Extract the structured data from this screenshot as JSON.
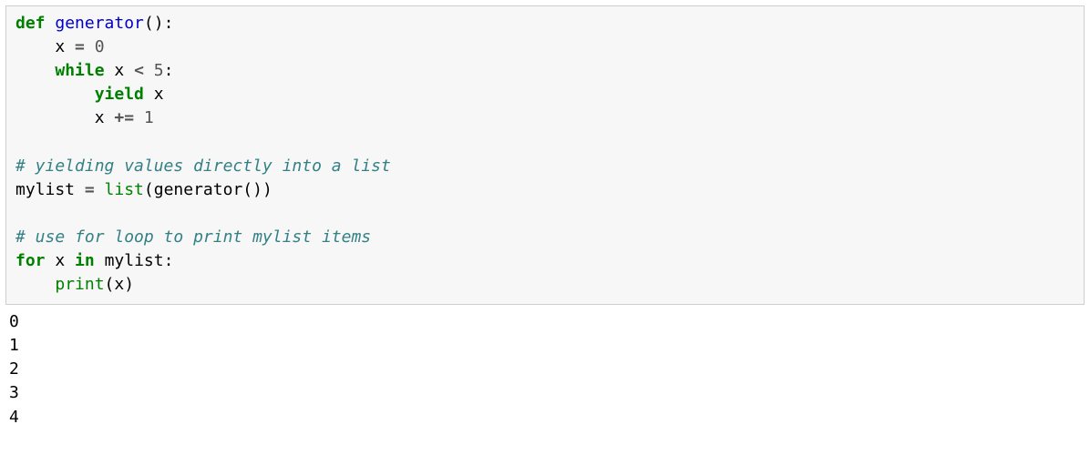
{
  "code": {
    "line1": {
      "def": "def",
      "sp1": " ",
      "fn": "generator",
      "paren": "():"
    },
    "line2": {
      "indent": "    ",
      "var": "x ",
      "op": "=",
      "sp": " ",
      "num": "0"
    },
    "line3": {
      "indent": "    ",
      "kw": "while",
      "sp1": " ",
      "var": "x ",
      "op": "<",
      "sp2": " ",
      "num": "5",
      "colon": ":"
    },
    "line4": {
      "indent": "        ",
      "kw": "yield",
      "sp": " ",
      "var": "x"
    },
    "line5": {
      "indent": "        ",
      "var": "x ",
      "op": "+=",
      "sp": " ",
      "num": "1"
    },
    "line6": "",
    "line7": {
      "comment": "# yielding values directly into a list"
    },
    "line8": {
      "var": "mylist ",
      "op": "=",
      "sp1": " ",
      "builtin": "list",
      "lpar": "(",
      "fn": "generator",
      "args": "())"
    },
    "line9": "",
    "line10": {
      "comment": "# use for loop to print mylist items"
    },
    "line11": {
      "kwfor": "for",
      "sp1": " ",
      "var": "x ",
      "kwin": "in",
      "sp2": " ",
      "var2": "mylist",
      "colon": ":"
    },
    "line12": {
      "indent": "    ",
      "builtin": "print",
      "lpar": "(",
      "arg": "x",
      "rpar": ")"
    }
  },
  "output": {
    "l1": "0",
    "l2": "1",
    "l3": "2",
    "l4": "3",
    "l5": "4"
  }
}
